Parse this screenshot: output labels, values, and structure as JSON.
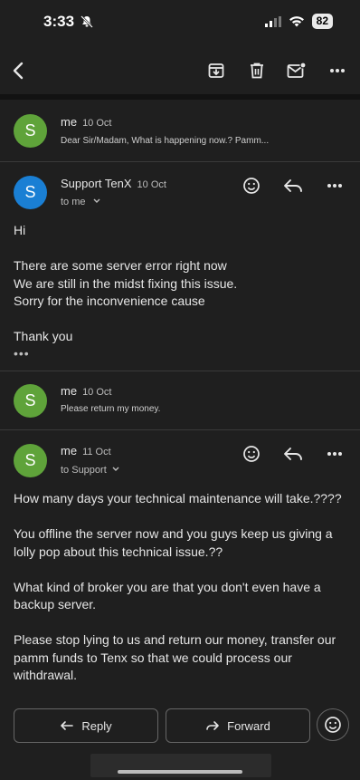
{
  "status_bar": {
    "time": "3:33",
    "battery": "82"
  },
  "toolbar": {
    "back_icon": "back-arrow-icon",
    "archive_icon": "archive-icon",
    "delete_icon": "trash-icon",
    "mark_unread_icon": "mail-unread-icon",
    "more_icon": "more-icon"
  },
  "messages": [
    {
      "sender": "me",
      "date": "10 Oct",
      "snippet": "Dear Sir/Madam, What is happening now.? Pamm...",
      "avatar": "S",
      "avatar_color": "#5fa33a"
    },
    {
      "sender": "Support TenX",
      "date": "10 Oct",
      "recipient": "to me",
      "avatar": "S",
      "avatar_color": "#1a7fd4",
      "body": [
        "Hi",
        "",
        "There are some server error right now",
        "We are still in the midst fixing this issue.",
        "Sorry for the inconvenience cause",
        "",
        "Thank you"
      ],
      "ellipsis": "•••"
    },
    {
      "sender": "me",
      "date": "10 Oct",
      "snippet": "Please return my money.",
      "avatar": "S",
      "avatar_color": "#5fa33a"
    },
    {
      "sender": "me",
      "date": "11 Oct",
      "recipient": "to Support",
      "avatar": "S",
      "avatar_color": "#5fa33a",
      "body": [
        "How many days your technical maintenance will take.????",
        "",
        "You offline the server now and you guys keep us giving a lolly pop about this technical issue.??",
        "",
        "What kind of broker you are that you don't even have a backup server.",
        "",
        "Please stop lying to us and return our money, transfer our pamm funds to Tenx so that we could process our withdrawal."
      ]
    }
  ],
  "bottom": {
    "reply": "Reply",
    "forward": "Forward"
  }
}
